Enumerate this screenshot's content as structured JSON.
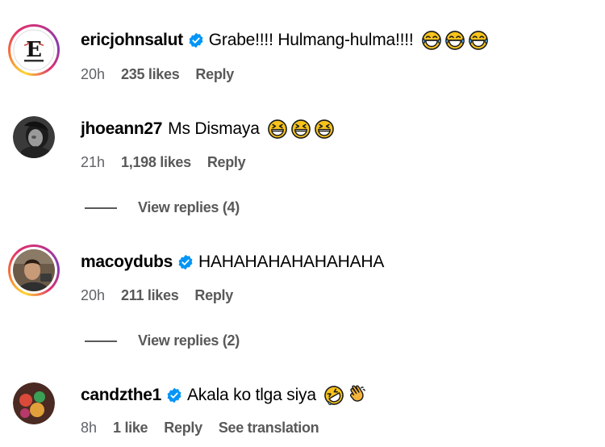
{
  "comments": [
    {
      "username": "ericjohnsalut",
      "verified": true,
      "text": "Grabe!!!! Hulmang-hulma!!!!",
      "emojis": [
        "face-with-tears-of-joy-icon",
        "face-with-tears-of-joy-icon",
        "face-with-tears-of-joy-icon"
      ],
      "time": "20h",
      "likes": "235 likes",
      "reply": "Reply"
    },
    {
      "username": "jhoeann27",
      "verified": false,
      "text": "Ms Dismaya",
      "emojis": [
        "grinning-squinting-face-icon",
        "grinning-squinting-face-icon",
        "grinning-squinting-face-icon"
      ],
      "time": "21h",
      "likes": "1,198 likes",
      "reply": "Reply",
      "view_replies": "View replies (4)"
    },
    {
      "username": "macoydubs",
      "verified": true,
      "text": "HAHAHAHAHAHAHAHA",
      "time": "20h",
      "likes": "211 likes",
      "reply": "Reply",
      "view_replies": "View replies (2)"
    },
    {
      "username": "candzthe1",
      "verified": true,
      "text": "Akala ko tlga siya",
      "emojis": [
        "rolling-on-floor-laughing-icon",
        "clapping-hands-icon"
      ],
      "time": "8h",
      "likes": "1 like",
      "reply": "Reply",
      "see_translation": "See translation"
    }
  ],
  "colors": {
    "verified_blue": "#0095f6",
    "meta_text": "#595959",
    "emoji_yellow": "#f7c31c"
  }
}
